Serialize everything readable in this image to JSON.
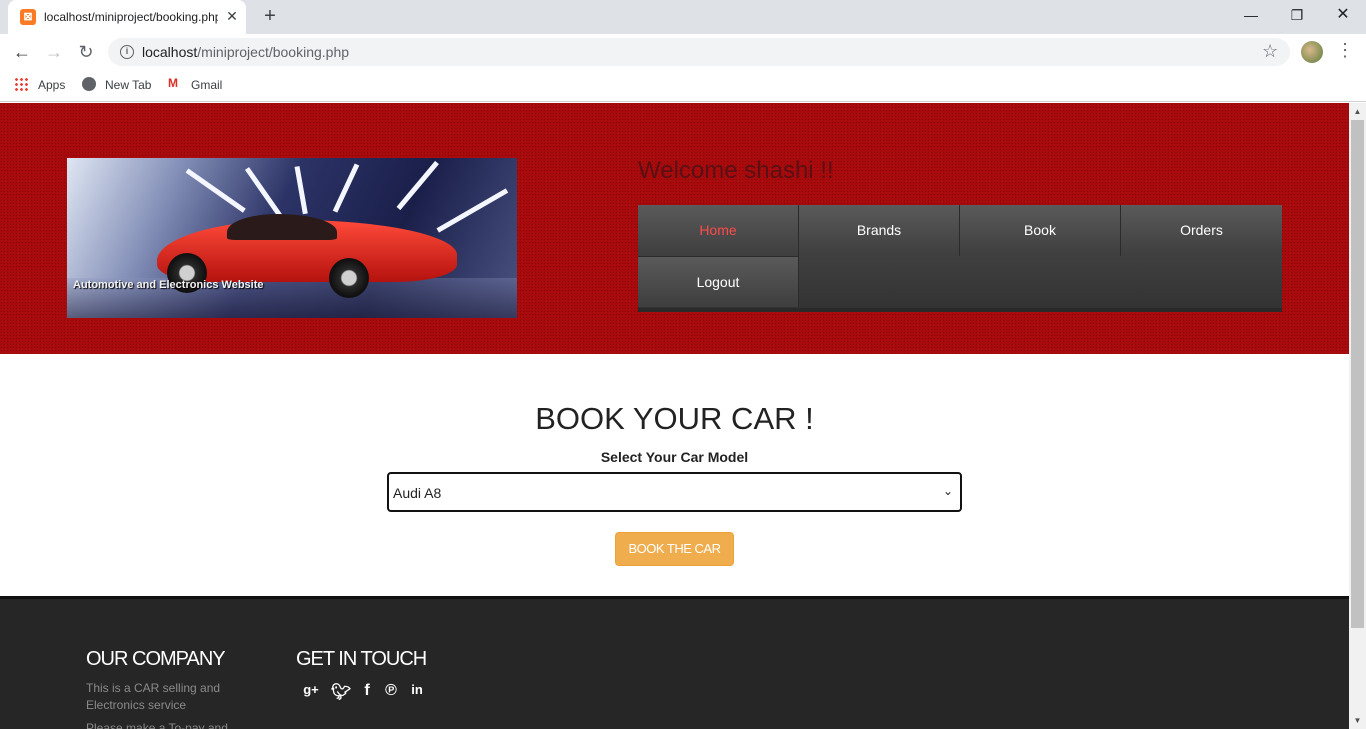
{
  "browser": {
    "tab_title": "localhost/miniproject/booking.php",
    "url_host": "localhost",
    "url_path": "/miniproject/booking.php",
    "bookmarks": [
      {
        "label": "Apps",
        "icon": "apps-grid-icon"
      },
      {
        "label": "New Tab",
        "icon": "globe-icon"
      },
      {
        "label": "Gmail",
        "icon": "gmail-icon"
      }
    ]
  },
  "header": {
    "banner_caption": "Automotive and Electronics Website",
    "welcome": "Welcome shashi !!",
    "menu": [
      {
        "label": "Home",
        "active": true
      },
      {
        "label": "Brands",
        "active": false
      },
      {
        "label": "Book",
        "active": false
      },
      {
        "label": "Orders",
        "active": false
      },
      {
        "label": "Logout",
        "active": false
      }
    ]
  },
  "booking": {
    "title": "BOOK YOUR CAR !",
    "select_label": "Select Your Car Model",
    "selected_model": "Audi A8",
    "button_label": "BOOK THE CAR"
  },
  "footer": {
    "company_heading": "OUR COMPANY",
    "company_text": "This is a CAR selling and Electronics service",
    "company_text_2": "Please make a To-pay and",
    "touch_heading": "GET IN TOUCH",
    "social_icons": [
      "google-plus-icon",
      "twitter-icon",
      "facebook-icon",
      "pinterest-icon",
      "linkedin-icon"
    ]
  },
  "colors": {
    "header_red": "#a8090b",
    "menu_active": "#ff4a4a",
    "button_orange": "#f0ad4e",
    "footer_bg": "#262626"
  }
}
